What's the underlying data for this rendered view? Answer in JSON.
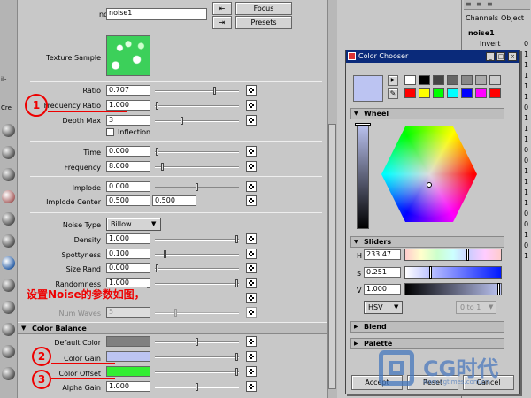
{
  "left_strip": {
    "labels": [
      "il-",
      "Cre"
    ]
  },
  "attr_editor": {
    "node_label": "noise:",
    "node_value": "noise1",
    "focus_label": "Focus",
    "presets_label": "Presets",
    "texture_sample_label": "Texture Sample",
    "fields": {
      "ratio": {
        "label": "Ratio",
        "value": "0.707"
      },
      "frequency_ratio": {
        "label": "Frequency Ratio",
        "value": "1.000"
      },
      "depth_max": {
        "label": "Depth Max",
        "value": "3"
      },
      "inflection": {
        "label": "Inflection"
      },
      "time": {
        "label": "Time",
        "value": "0.000"
      },
      "frequency": {
        "label": "Frequency",
        "value": "8.000"
      },
      "implode": {
        "label": "Implode",
        "value": "0.000"
      },
      "implode_center": {
        "label": "Implode Center",
        "value1": "0.500",
        "value2": "0.500"
      },
      "noise_type": {
        "label": "Noise Type",
        "value": "Billow"
      },
      "density": {
        "label": "Density",
        "value": "1.000"
      },
      "spottyness": {
        "label": "Spottyness",
        "value": "0.100"
      },
      "size_rand": {
        "label": "Size Rand",
        "value": "0.000"
      },
      "randomness": {
        "label": "Randomness",
        "value": "1.000"
      },
      "falloff": {
        "label": "Falloff"
      },
      "num_waves": {
        "label": "Num Waves",
        "value": "5"
      },
      "default_color": {
        "label": "Default Color"
      },
      "color_gain": {
        "label": "Color Gain"
      },
      "color_offset": {
        "label": "Color Offset"
      },
      "alpha_gain": {
        "label": "Alpha Gain",
        "value": "1.000"
      }
    },
    "color_balance_header": "Color Balance",
    "annotation_text": "设置Noise的参数如图，",
    "annotation_numbers": [
      "1",
      "2",
      "3"
    ],
    "colors": {
      "default_color": "#808080",
      "color_gain": "#bcc4f2",
      "color_offset": "#33ee33"
    }
  },
  "channel_box": {
    "tabs": [
      "Channels",
      "Object"
    ],
    "node": "noise1",
    "attr_label": "Invert",
    "values": [
      "0",
      "1",
      "1",
      "1",
      "1",
      "1",
      "0",
      "1",
      "1",
      "1",
      "0",
      "0",
      "1",
      "1",
      "1",
      "1",
      "0",
      "0",
      "1",
      "0",
      "1"
    ]
  },
  "color_chooser": {
    "title": "Color Chooser",
    "title_buttons": [
      "_",
      "□",
      "×"
    ],
    "wheel_label": "Wheel",
    "sliders_label": "Sliders",
    "h": {
      "label": "H",
      "value": "233.47"
    },
    "s": {
      "label": "S",
      "value": "0.251"
    },
    "v": {
      "label": "V",
      "value": "1.000"
    },
    "mode": "HSV",
    "range": "0 to 1",
    "blend_label": "Blend",
    "palette_label": "Palette",
    "accept_label": "Accept",
    "reset_label": "Reset",
    "cancel_label": "Cancel",
    "current_color": "#bcc4f2",
    "palette_colors": [
      "#ffffff",
      "#000000",
      "#444444",
      "#666666",
      "#888888",
      "#aaaaaa",
      "#cccccc",
      "#ff0000",
      "#ffff00",
      "#00ff00",
      "#00ffff",
      "#0000ff",
      "#ff00ff",
      "#ff0000"
    ]
  },
  "watermark": {
    "text": "CG时代",
    "url": "www.cgtimes.com.cn"
  }
}
